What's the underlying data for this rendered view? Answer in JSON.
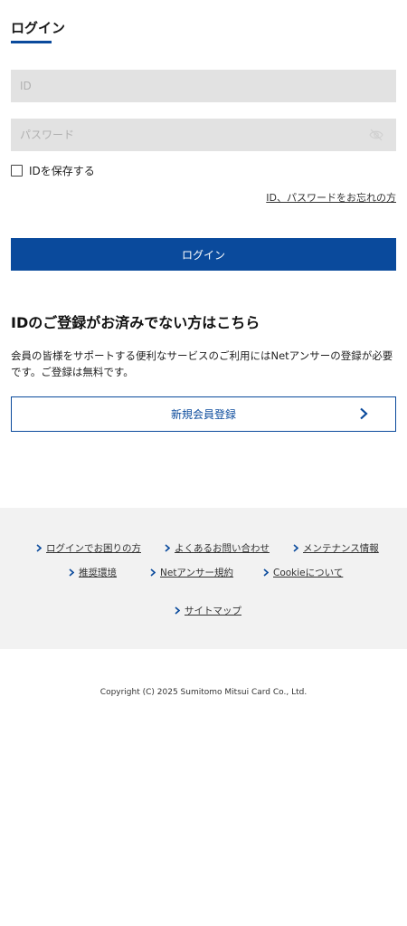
{
  "login": {
    "title": "ログイン",
    "id_placeholder": "ID",
    "password_placeholder": "パスワード",
    "remember_label": "IDを保存する",
    "forgot_link": "ID、パスワードをお忘れの方",
    "submit_label": "ログイン"
  },
  "register": {
    "heading": "IDのご登録がお済みでない方はこちら",
    "description": "会員の皆様をサポートする便利なサービスのご利用にはNetアンサーの登録が必要です。ご登録は無料です。",
    "button_label": "新規会員登録"
  },
  "footer": {
    "links": [
      {
        "label": "ログインでお困りの方"
      },
      {
        "label": "よくあるお問い合わせ"
      },
      {
        "label": "メンテナンス情報"
      },
      {
        "label": "推奨環境"
      },
      {
        "label": "Netアンサー規約"
      },
      {
        "label": "Cookieについて"
      },
      {
        "label": "サイトマップ"
      }
    ],
    "copyright": "Copyright (C) 2025 Sumitomo Mitsui Card Co., Ltd."
  },
  "colors": {
    "primary": "#0a4a9c",
    "field_bg": "#e2e2e2",
    "footer_bg": "#f2f2f2"
  }
}
